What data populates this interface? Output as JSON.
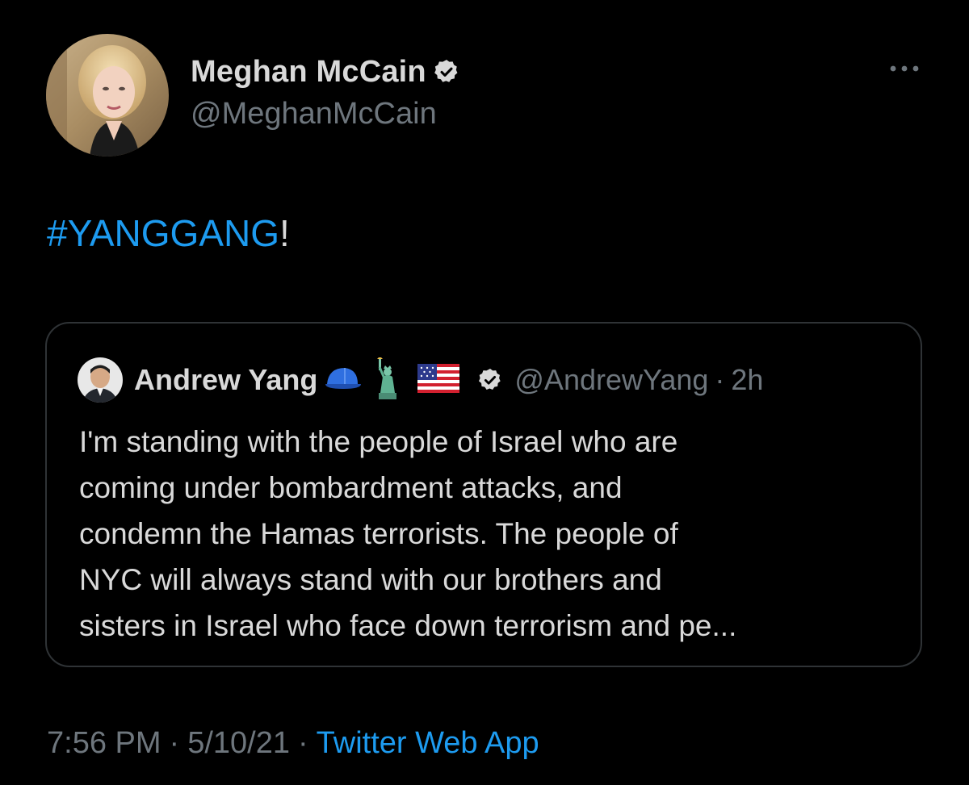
{
  "author": {
    "display_name": "Meghan McCain",
    "handle": "@MeghanMcCain",
    "verified_icon": "verified-badge-icon",
    "avatar": "profile-photo"
  },
  "tweet": {
    "hashtag": "#YANGGANG",
    "suffix": "!"
  },
  "quoted_tweet": {
    "display_name": "Andrew Yang",
    "emojis": [
      "blue-cap-emoji",
      "statue-of-liberty-emoji",
      "us-flag-emoji"
    ],
    "handle": "@AndrewYang",
    "separator": "·",
    "time": "2h",
    "lines": [
      "I'm standing with the people of Israel who are",
      "coming under bombardment attacks, and",
      "condemn the Hamas terrorists. The people of",
      "NYC will always stand with our brothers and",
      "sisters in Israel who face down terrorism and pe..."
    ]
  },
  "footer": {
    "time": "7:56 PM",
    "separator": "·",
    "date": "5/10/21",
    "source": "Twitter Web App"
  },
  "colors": {
    "background": "#000000",
    "text": "#d9d9d9",
    "secondary": "#6e767d",
    "accent": "#1d9bf0",
    "border": "#2f3336"
  }
}
